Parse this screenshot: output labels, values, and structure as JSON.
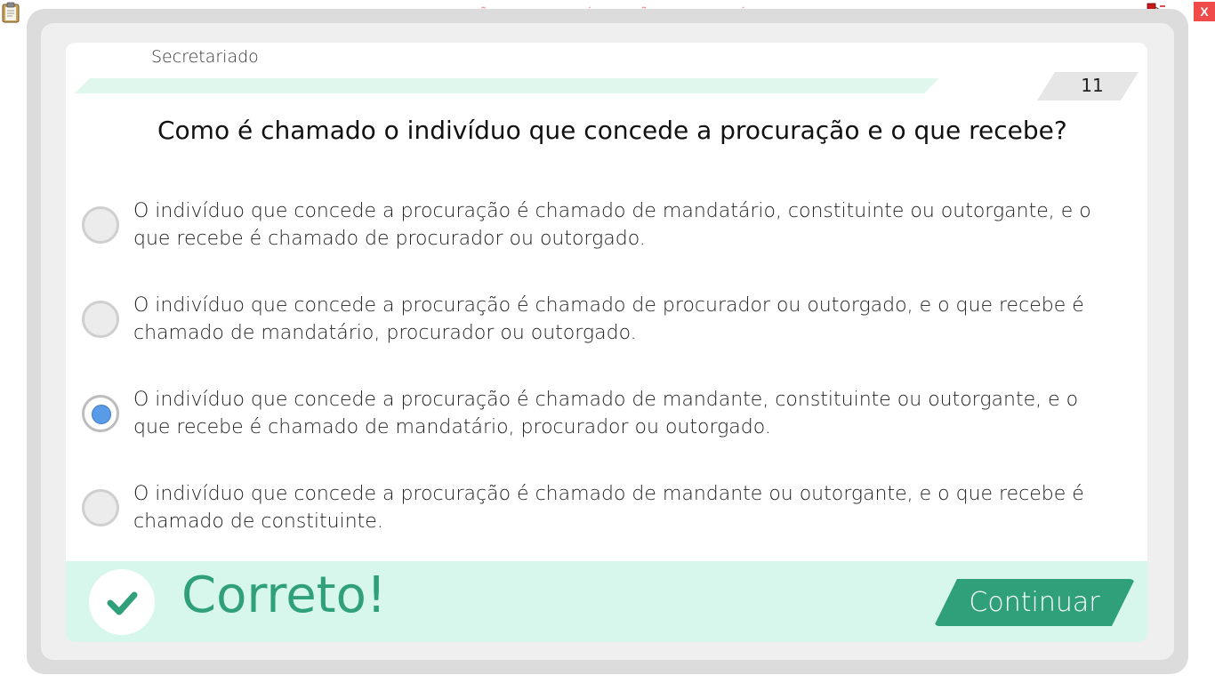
{
  "banner": {
    "text": "VERSÃO PARA FUNCIONÁRIOS - NÃO COMERCIALIZÁVEL"
  },
  "window": {
    "close_label": "X"
  },
  "icons": {
    "clipboard": "clipboard-icon",
    "network": "network-icon",
    "check": "check-icon"
  },
  "header": {
    "subject": "Secretariado",
    "question_number": "11",
    "progress_fraction": 0.86
  },
  "question": {
    "text": "Como é chamado o indivíduo que concede a procuração e o que recebe?"
  },
  "options": [
    {
      "text": "O indivíduo que concede a procuração é chamado de mandatário, constituinte ou outorgante, e o que recebe é chamado de  procurador ou outorgado.",
      "selected": false
    },
    {
      "text": "O indivíduo que concede a procuração é chamado de procurador ou outorgado, e o que recebe é chamado de mandatário, procurador ou outorgado.",
      "selected": false
    },
    {
      "text": "O indivíduo que concede a procuração é chamado de mandante, constituinte ou outorgante, e o que recebe é chamado de mandatário, procurador ou outorgado.",
      "selected": true
    },
    {
      "text": "O indivíduo que concede a procuração é chamado de mandante ou outorgante, e o que recebe é chamado de constituinte.",
      "selected": false
    }
  ],
  "feedback": {
    "text": "Correto!",
    "continue_label": "Continuar"
  },
  "colors": {
    "accent": "#2fa07a",
    "feedback_bg": "#d8f7ec",
    "radio_selected": "#5a9be8",
    "banner_text": "#f07070",
    "close_bg": "#f04a4a"
  }
}
